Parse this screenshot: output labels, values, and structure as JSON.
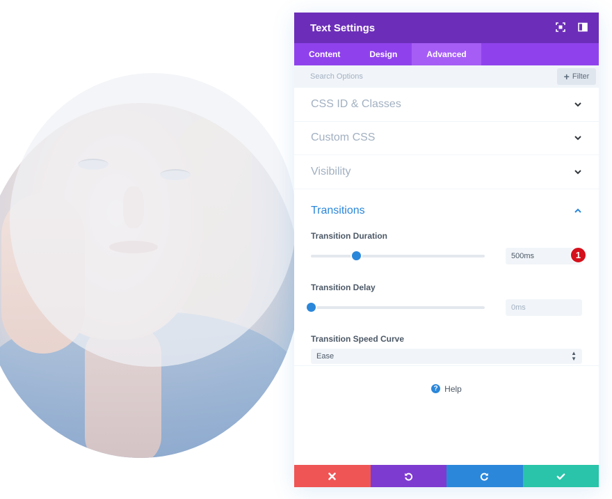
{
  "panel": {
    "title": "Text Settings",
    "header_icons": [
      "fullscreen-icon",
      "sidebar-toggle-icon"
    ],
    "tabs": [
      {
        "label": "Content",
        "active": false
      },
      {
        "label": "Design",
        "active": false
      },
      {
        "label": "Advanced",
        "active": true
      }
    ]
  },
  "search": {
    "placeholder": "Search Options",
    "filter_label": "Filter"
  },
  "toggles": [
    {
      "label": "CSS ID & Classes",
      "open": false
    },
    {
      "label": "Custom CSS",
      "open": false
    },
    {
      "label": "Visibility",
      "open": false
    }
  ],
  "transitions": {
    "title": "Transitions",
    "open": true,
    "duration": {
      "label": "Transition Duration",
      "value": "500ms",
      "slider_fraction": 0.26
    },
    "delay": {
      "label": "Transition Delay",
      "value": "0ms",
      "slider_fraction": 0.0
    },
    "curve": {
      "label": "Transition Speed Curve",
      "selected": "Ease"
    },
    "marker": "1"
  },
  "help": {
    "label": "Help"
  },
  "footer": {
    "buttons": [
      "discard",
      "undo",
      "redo",
      "save"
    ]
  },
  "colors": {
    "header": "#6c2eb9",
    "tabs": "#8f42ec",
    "active_tab": "#a65df5",
    "accent_blue": "#2b87da",
    "discard": "#ef5555",
    "undo": "#7e3bd0",
    "redo": "#2b87da",
    "save": "#29c4a9",
    "marker": "#d4101c"
  }
}
